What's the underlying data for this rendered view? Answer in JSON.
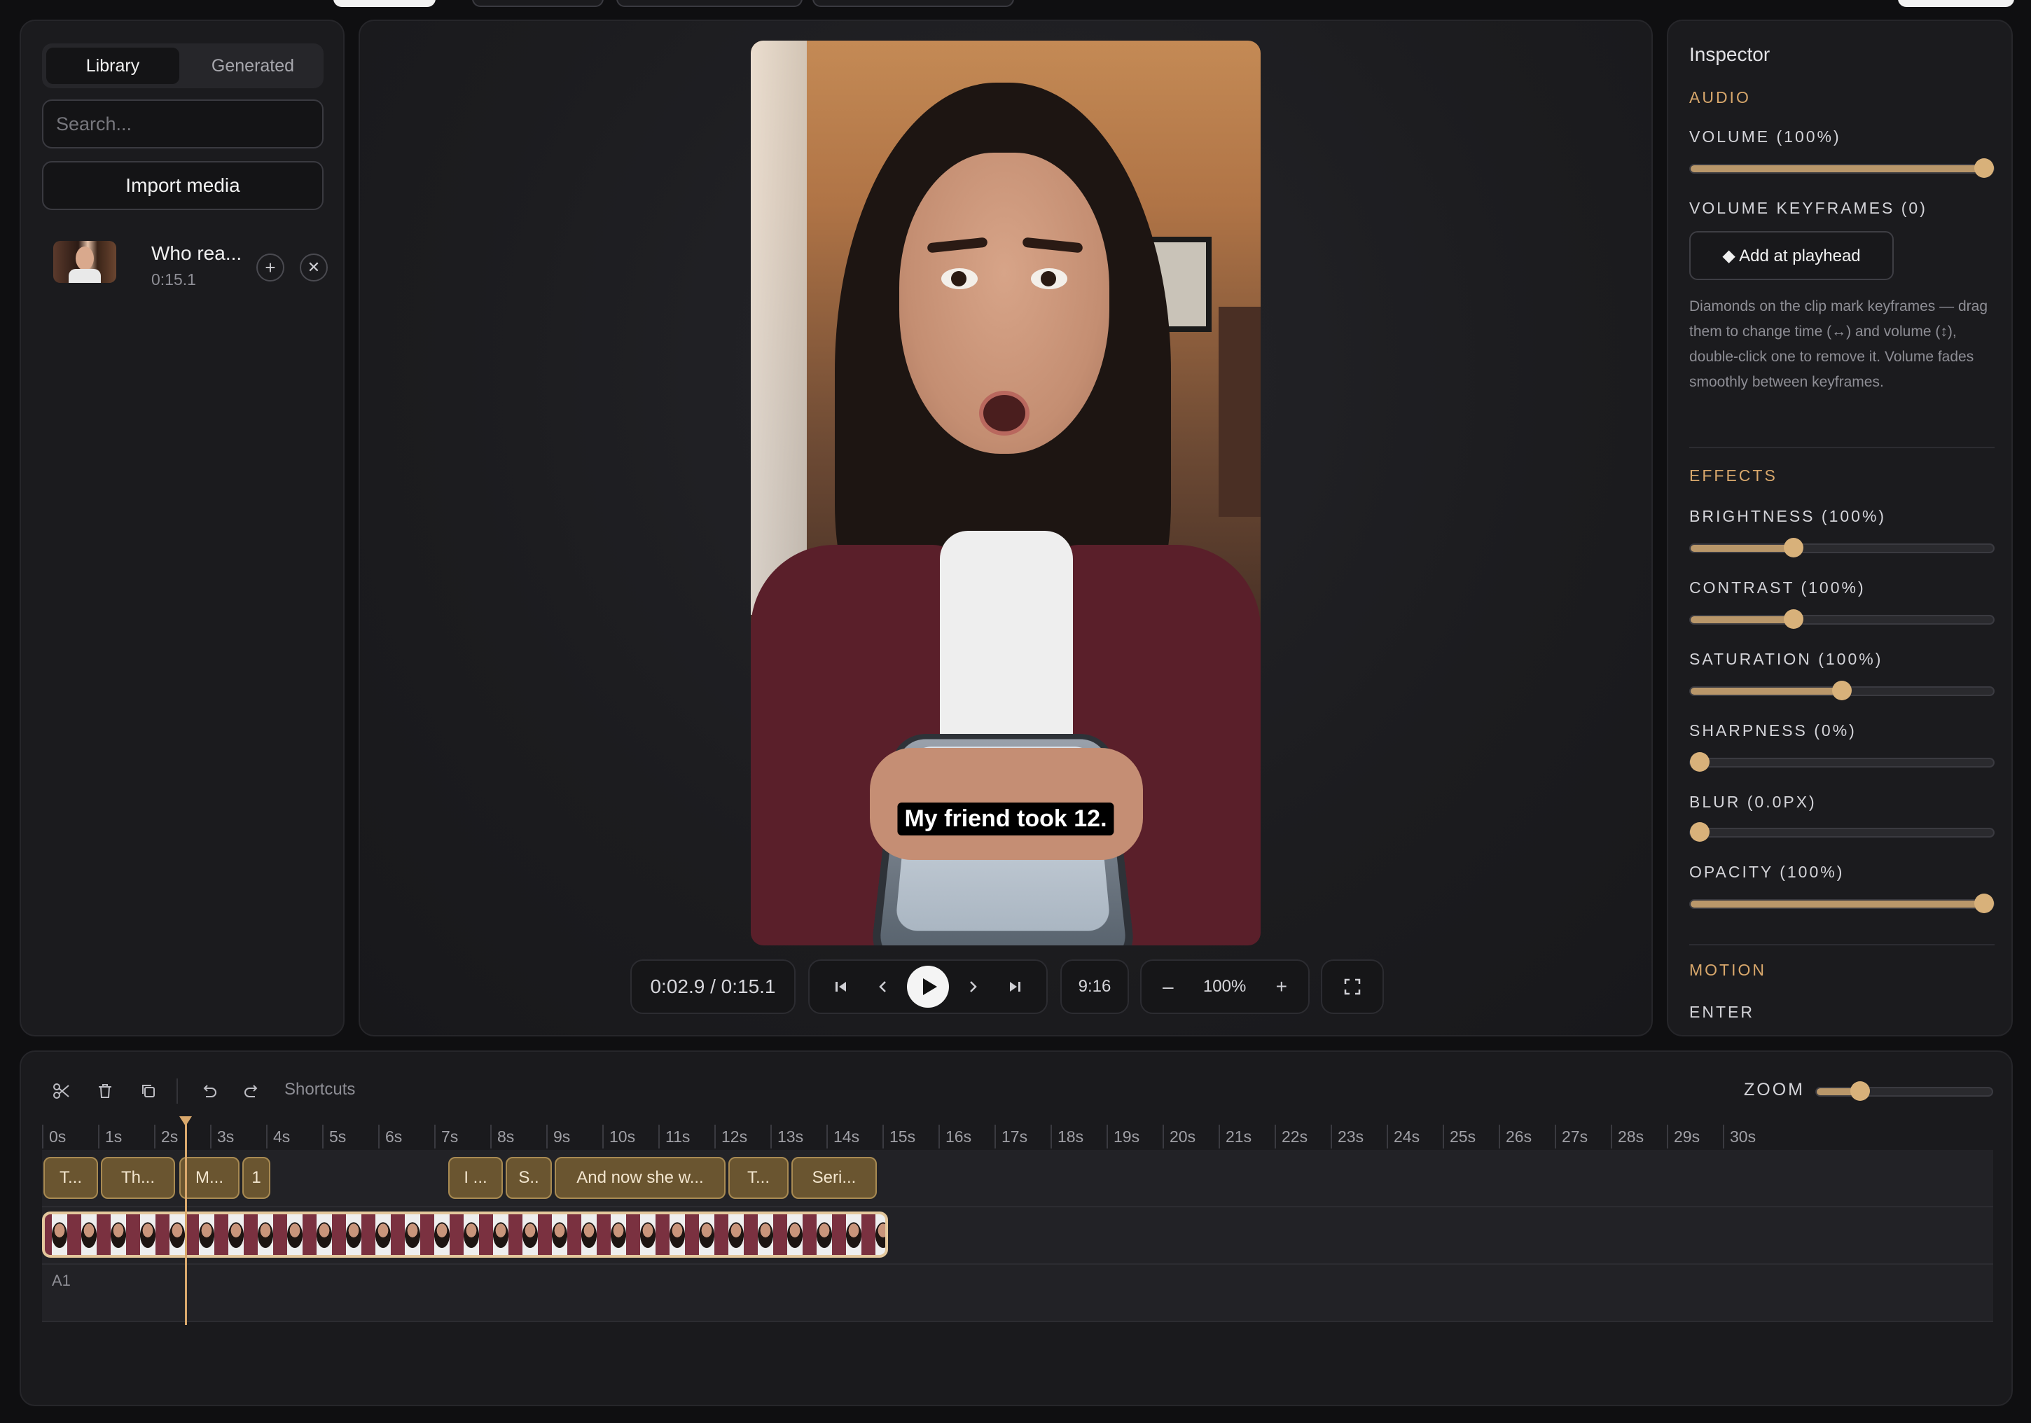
{
  "library": {
    "tabs": [
      {
        "label": "Library"
      },
      {
        "label": "Generated"
      }
    ],
    "search_placeholder": "Search...",
    "import_label": "Import media",
    "items": [
      {
        "name": "Who rea...",
        "duration": "0:15.1",
        "add_symbol": "+",
        "remove_symbol": "✕"
      }
    ]
  },
  "preview": {
    "caption": "My friend took 12.",
    "time": "0:02.9 / 0:15.1",
    "aspect": "9:16",
    "zoom_minus": "–",
    "zoom": "100%",
    "zoom_plus": "+"
  },
  "inspector": {
    "title": "Inspector",
    "audio_heading": "AUDIO",
    "volume_label": "VOLUME (100%)",
    "volume_value": 1.0,
    "keyframes_label": "VOLUME KEYFRAMES (0)",
    "add_keyframe_label": "◆ Add at playhead",
    "help_text": "Diamonds on the clip mark keyframes — drag them to change time (↔) and volume (↕), double-click one to remove it. Volume fades smoothly between keyframes.",
    "effects_heading": "EFFECTS",
    "effects": [
      {
        "label": "BRIGHTNESS (100%)",
        "value": 0.34
      },
      {
        "label": "CONTRAST (100%)",
        "value": 0.34
      },
      {
        "label": "SATURATION (100%)",
        "value": 0.5
      },
      {
        "label": "SHARPNESS (0%)",
        "value": 0.0
      },
      {
        "label": "BLUR (0.0PX)",
        "value": 0.0
      },
      {
        "label": "OPACITY (100%)",
        "value": 1.0
      }
    ],
    "motion_heading": "MOTION",
    "enter_label": "ENTER"
  },
  "timeline": {
    "shortcuts_label": "Shortcuts",
    "zoom_label": "ZOOM",
    "zoom_value": 0.25,
    "ruler": [
      "0s",
      "1s",
      "2s",
      "3s",
      "4s",
      "5s",
      "6s",
      "7s",
      "8s",
      "9s",
      "10s",
      "11s",
      "12s",
      "13s",
      "14s",
      "15s",
      "16s",
      "17s",
      "18s",
      "19s",
      "20s",
      "21s",
      "22s",
      "23s",
      "24s",
      "25s",
      "26s",
      "27s",
      "28s",
      "29s",
      "30s"
    ],
    "caption_clips": [
      {
        "label": "T..."
      },
      {
        "label": "Th..."
      },
      {
        "label": "M..."
      },
      {
        "label": "1"
      },
      {
        "label": "I ..."
      },
      {
        "label": "S.."
      },
      {
        "label": "And now she w..."
      },
      {
        "label": "T..."
      },
      {
        "label": "Seri..."
      }
    ],
    "audio_track_label": "A1"
  },
  "colors": {
    "accent": "#d9a86c",
    "panel": "#1b1b1e",
    "background": "#0f0f11"
  }
}
